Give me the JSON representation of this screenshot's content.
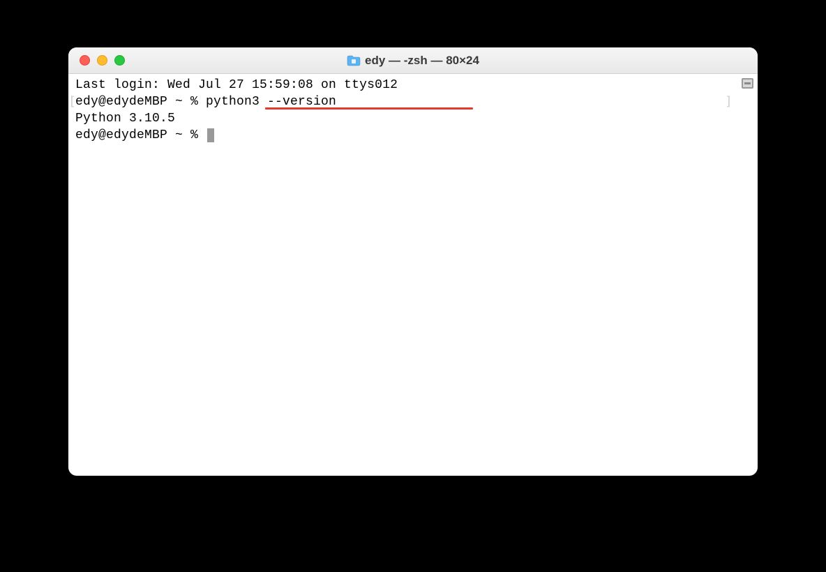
{
  "window": {
    "title": "edy — -zsh — 80×24"
  },
  "terminal": {
    "last_login": "Last login: Wed Jul 27 15:59:08 on ttys012",
    "prompt1_prefix": "edy@edydeMBP ~ % ",
    "command1": "python3 --version",
    "output1": "Python 3.10.5",
    "prompt2": "edy@edydeMBP ~ % "
  }
}
